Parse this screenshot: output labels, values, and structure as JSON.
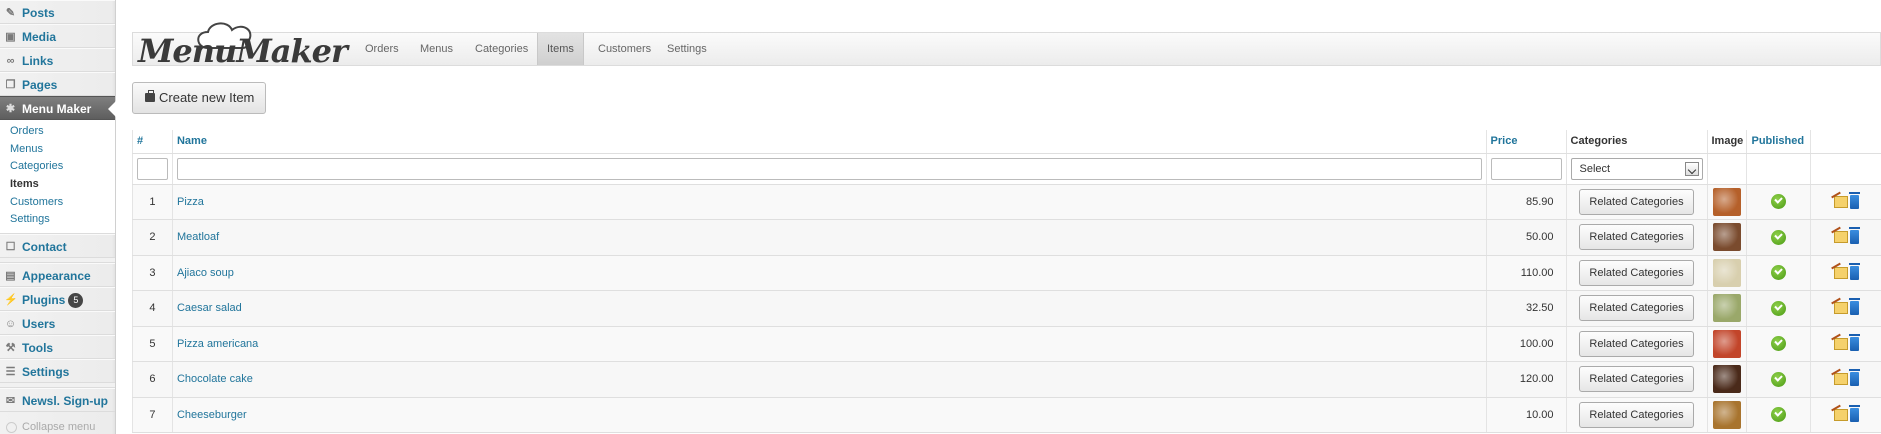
{
  "sidebar": {
    "top_items": [
      {
        "label": "Posts",
        "icon": "pushpin-icon"
      },
      {
        "label": "Media",
        "icon": "media-icon"
      },
      {
        "label": "Links",
        "icon": "link-icon"
      },
      {
        "label": "Pages",
        "icon": "pages-icon"
      }
    ],
    "current": {
      "label": "Menu Maker",
      "icon": "gear-icon"
    },
    "submenu": [
      "Orders",
      "Menus",
      "Categories",
      "Items",
      "Customers",
      "Settings"
    ],
    "submenu_current": "Items",
    "contact": "Contact",
    "bottom_items": [
      {
        "label": "Appearance",
        "icon": "appearance-icon"
      },
      {
        "label": "Plugins",
        "icon": "plugin-icon",
        "badge": "5"
      },
      {
        "label": "Users",
        "icon": "users-icon"
      },
      {
        "label": "Tools",
        "icon": "tools-icon"
      },
      {
        "label": "Settings",
        "icon": "settings-icon"
      }
    ],
    "newsletter": "Newsl. Sign-up",
    "collapse": "Collapse menu"
  },
  "header": {
    "logo_text": "MenuMaker",
    "tabs": [
      "Orders",
      "Menus",
      "Categories",
      "Items",
      "Customers",
      "Settings"
    ],
    "active_tab": "Items"
  },
  "create_button": "Create new Item",
  "table": {
    "columns": {
      "num": "#",
      "name": "Name",
      "price": "Price",
      "categories": "Categories",
      "image": "Image",
      "published": "Published"
    },
    "select_placeholder": "Select",
    "related_label": "Related Categories",
    "rows": [
      {
        "num": "1",
        "name": "Pizza",
        "price": "85.90",
        "thumb": "#b5602a"
      },
      {
        "num": "2",
        "name": "Meatloaf",
        "price": "50.00",
        "thumb": "#7a4b2e"
      },
      {
        "num": "3",
        "name": "Ajiaco soup",
        "price": "110.00",
        "thumb": "#d8cfae"
      },
      {
        "num": "4",
        "name": "Caesar salad",
        "price": "32.50",
        "thumb": "#9aa86a"
      },
      {
        "num": "5",
        "name": "Pizza americana",
        "price": "100.00",
        "thumb": "#c2452a"
      },
      {
        "num": "6",
        "name": "Chocolate cake",
        "price": "120.00",
        "thumb": "#4a2a1a"
      },
      {
        "num": "7",
        "name": "Cheeseburger",
        "price": "10.00",
        "thumb": "#a8742e"
      }
    ]
  },
  "colors": {
    "link": "#21759b",
    "sidebar_current": "#6a6a6a",
    "published": "#5aa81e"
  }
}
